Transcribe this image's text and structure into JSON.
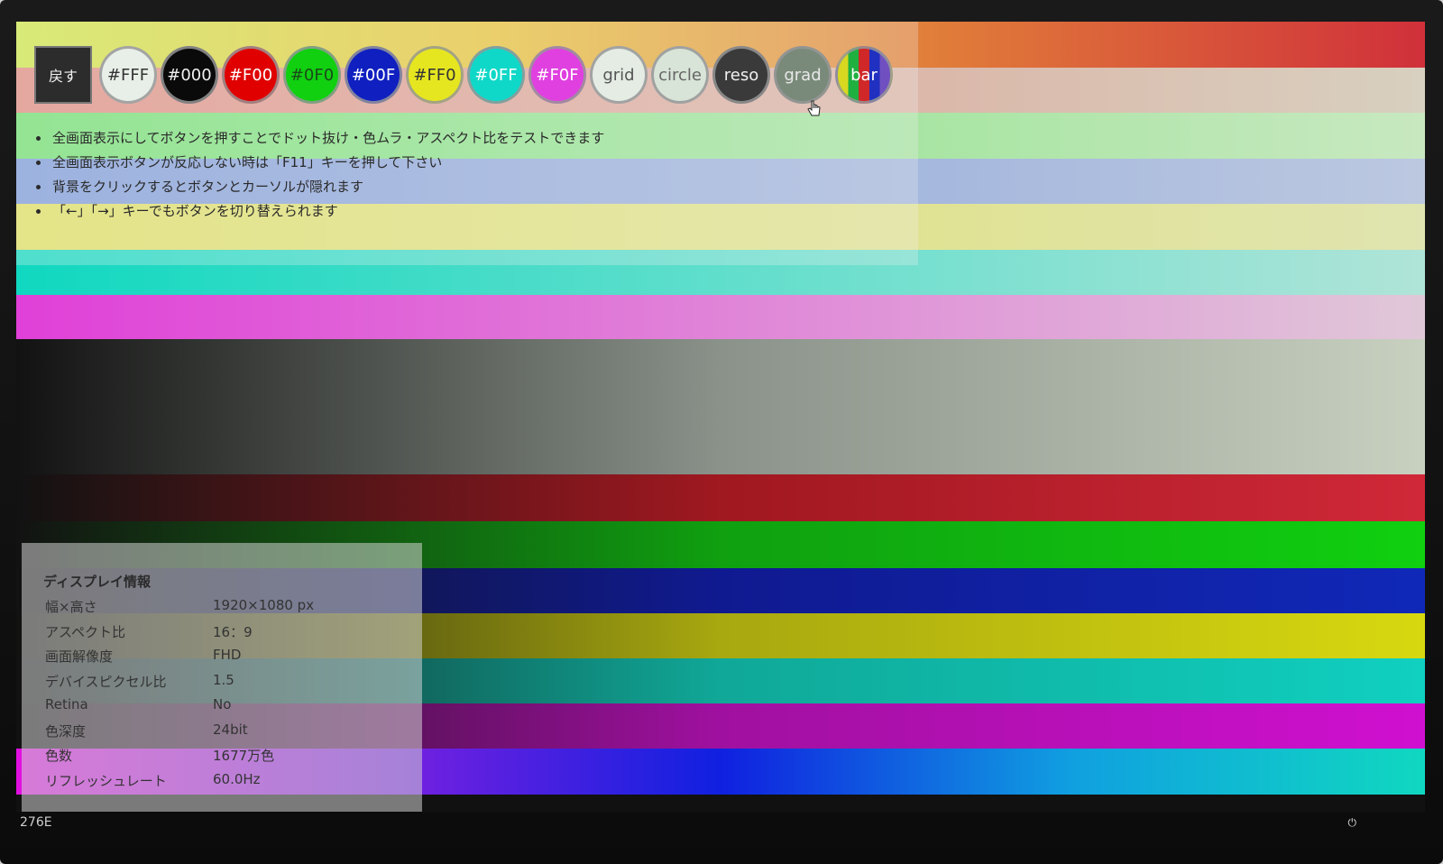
{
  "toolbar": {
    "back_label": "戻す",
    "buttons": [
      {
        "label": "#FFF",
        "bg": "#e8eee8",
        "fg": "#333333"
      },
      {
        "label": "#000",
        "bg": "#0a0a0a",
        "fg": "#f0f0f0"
      },
      {
        "label": "#F00",
        "bg": "#e00000",
        "fg": "#ffffff"
      },
      {
        "label": "#0F0",
        "bg": "#10d010",
        "fg": "#1a4a1a"
      },
      {
        "label": "#00F",
        "bg": "#1020c0",
        "fg": "#ffffff"
      },
      {
        "label": "#FF0",
        "bg": "#e6e620",
        "fg": "#333333"
      },
      {
        "label": "#0FF",
        "bg": "#10d8c8",
        "fg": "#ffffff"
      },
      {
        "label": "#F0F",
        "bg": "#e040e0",
        "fg": "#ffffff"
      },
      {
        "label": "grid",
        "bg": "#e4ece4",
        "fg": "#555555"
      },
      {
        "label": "circle",
        "bg": "#d8e4d8",
        "fg": "#666666"
      },
      {
        "label": "reso",
        "bg": "#3a3a3a",
        "fg": "#f0f0f0"
      },
      {
        "label": "grad",
        "bg": "#7a8a7a",
        "fg": "#e8e8e8"
      },
      {
        "label": "bar",
        "bg": "#4a4ad0",
        "fg": "#ffffff"
      }
    ]
  },
  "notes": [
    "全画面表示にしてボタンを押すことでドット抜け・色ムラ・アスペクト比をテストできます",
    "全画面表示ボタンが反応しない時は「F11」キーを押して下さい",
    "背景をクリックするとボタンとカーソルが隠れます",
    "「←」「→」キーでもボタンを切り替えられます"
  ],
  "info": {
    "title": "ディスプレイ情報",
    "rows": [
      {
        "key": "幅×高さ",
        "value": "1920×1080 px"
      },
      {
        "key": "アスペクト比",
        "value": "16：9"
      },
      {
        "key": "画面解像度",
        "value": "FHD"
      },
      {
        "key": "デバイスピクセル比",
        "value": "1.5"
      },
      {
        "key": "Retina",
        "value": "No"
      },
      {
        "key": "色深度",
        "value": "24bit"
      },
      {
        "key": "色数",
        "value": "1677万色"
      },
      {
        "key": "リフレッシュレート",
        "value": "60.0Hz"
      }
    ]
  },
  "monitor": {
    "model": "276E"
  },
  "top_bars": [
    {
      "name": "rainbow",
      "colors": [
        "#cfe84a",
        "#e8c43a",
        "#e07a3a",
        "#d0303a"
      ]
    },
    {
      "name": "red-fade",
      "colors": [
        "#e08c80",
        "#d8d0c0"
      ]
    },
    {
      "name": "green-fade",
      "colors": [
        "#70e070",
        "#c8e8c0"
      ]
    },
    {
      "name": "blue-fade",
      "colors": [
        "#7c9ad8",
        "#bcc8e0"
      ]
    },
    {
      "name": "yellow-fade",
      "colors": [
        "#e0e060",
        "#e0e4b0"
      ]
    },
    {
      "name": "cyan-fade",
      "colors": [
        "#10d8c0",
        "#b0e4d8"
      ]
    },
    {
      "name": "magenta-fade",
      "colors": [
        "#e040d8",
        "#e0c8d8"
      ]
    }
  ],
  "bottom_bars": [
    {
      "name": "gray-grad",
      "colors": [
        "#121212",
        "#8a928a",
        "#c8d0c0"
      ]
    },
    {
      "name": "red-grad",
      "colors": [
        "#121212",
        "#a01820",
        "#d02838"
      ]
    },
    {
      "name": "green-grad",
      "colors": [
        "#121212",
        "#10a010",
        "#10d010"
      ]
    },
    {
      "name": "blue-grad",
      "colors": [
        "#121212",
        "#101a90",
        "#1028b8"
      ]
    },
    {
      "name": "yellow-grad",
      "colors": [
        "#121212",
        "#a8a810",
        "#d8d810"
      ]
    },
    {
      "name": "cyan-grad",
      "colors": [
        "#121212",
        "#10a898",
        "#10d0c0"
      ]
    },
    {
      "name": "magenta-grad",
      "colors": [
        "#121212",
        "#a010a0",
        "#d010d0"
      ]
    },
    {
      "name": "hue-spectrum",
      "colors": [
        "#e010e0",
        "#8020e0",
        "#1020e0",
        "#10a0e0",
        "#10d8c0"
      ]
    }
  ]
}
